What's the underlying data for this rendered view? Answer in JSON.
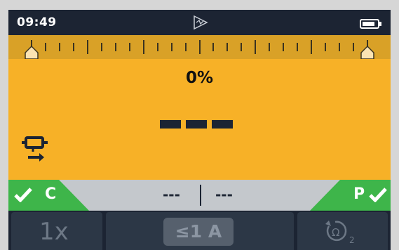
{
  "status": {
    "time": "09:49",
    "center_icon": "signal-triangle-icon",
    "battery_icon": "battery-icon"
  },
  "ruler": {
    "ticks": 25,
    "left_marker": 0,
    "right_marker": 1
  },
  "display": {
    "percent": "0%",
    "dashes": 3,
    "mode_icon": "clamp-direction-icon"
  },
  "result": {
    "left_flag": {
      "label": "C",
      "icon": "check-icon"
    },
    "right_flag": {
      "label": "P",
      "icon": "check-icon"
    },
    "reading_left": "---",
    "reading_right": "---"
  },
  "softkeys": {
    "key1_label": "1x",
    "key2_label": "≤1 A",
    "key3_icon": "ohm-reset-icon",
    "key3_sub": "2"
  },
  "colors": {
    "display_bg": "#f7b127",
    "ruler_bg": "#d9a127",
    "pass_green": "#3eb54a",
    "frame": "#1c2433"
  }
}
